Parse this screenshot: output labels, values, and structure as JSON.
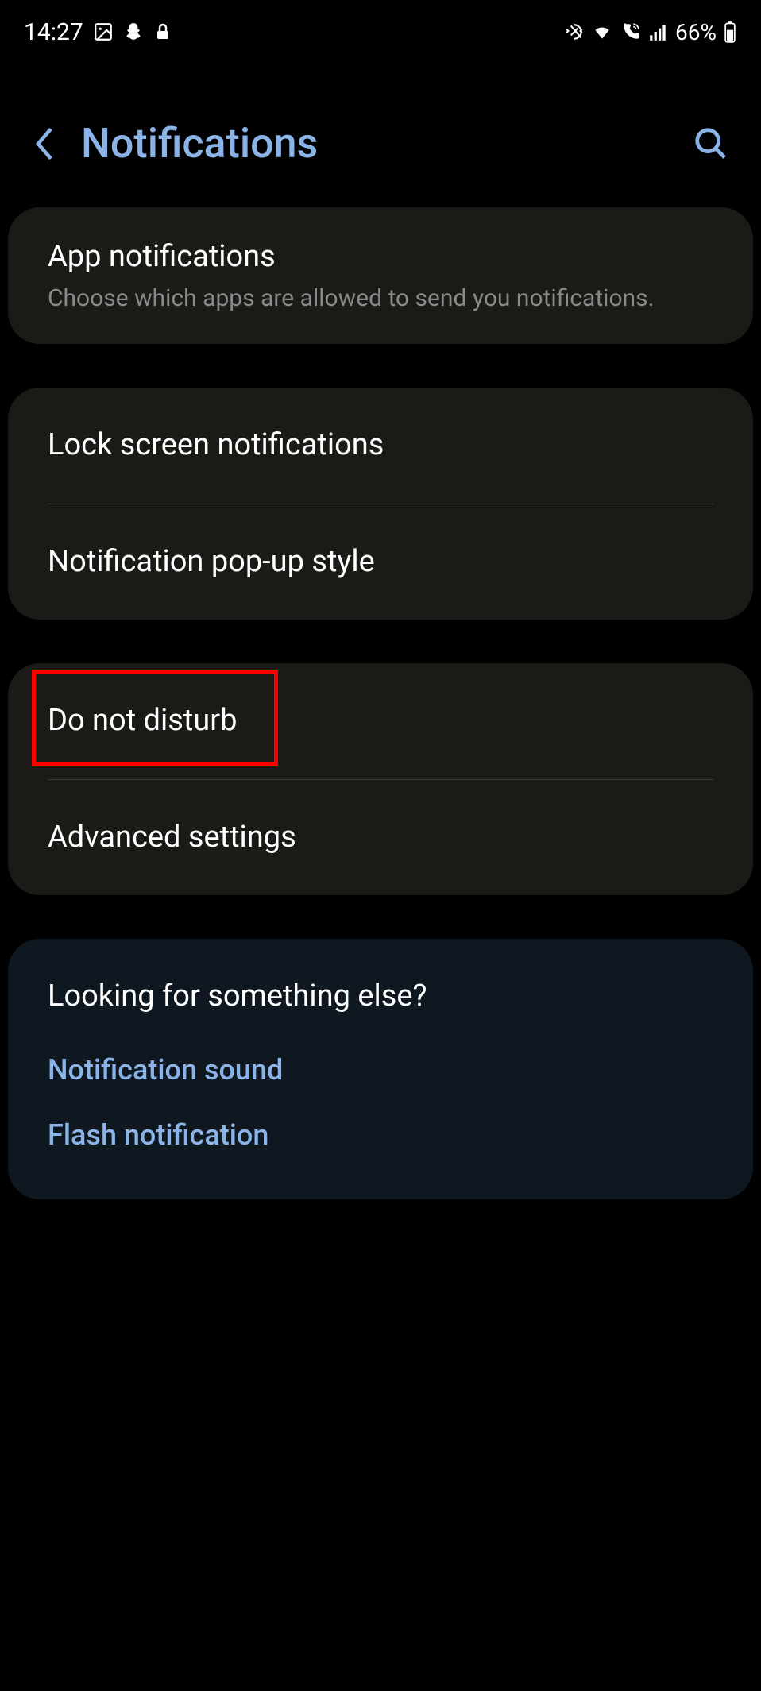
{
  "status_bar": {
    "time": "14:27",
    "battery_percent": "66%"
  },
  "header": {
    "title": "Notifications"
  },
  "sections": {
    "app_notifications": {
      "title": "App notifications",
      "subtitle": "Choose which apps are allowed to send you notifications."
    },
    "lock_screen": {
      "title": "Lock screen notifications"
    },
    "popup_style": {
      "title": "Notification pop-up style"
    },
    "do_not_disturb": {
      "title": "Do not disturb"
    },
    "advanced": {
      "title": "Advanced settings"
    }
  },
  "footer": {
    "heading": "Looking for something else?",
    "links": {
      "notification_sound": "Notification sound",
      "flash_notification": "Flash notification"
    }
  }
}
